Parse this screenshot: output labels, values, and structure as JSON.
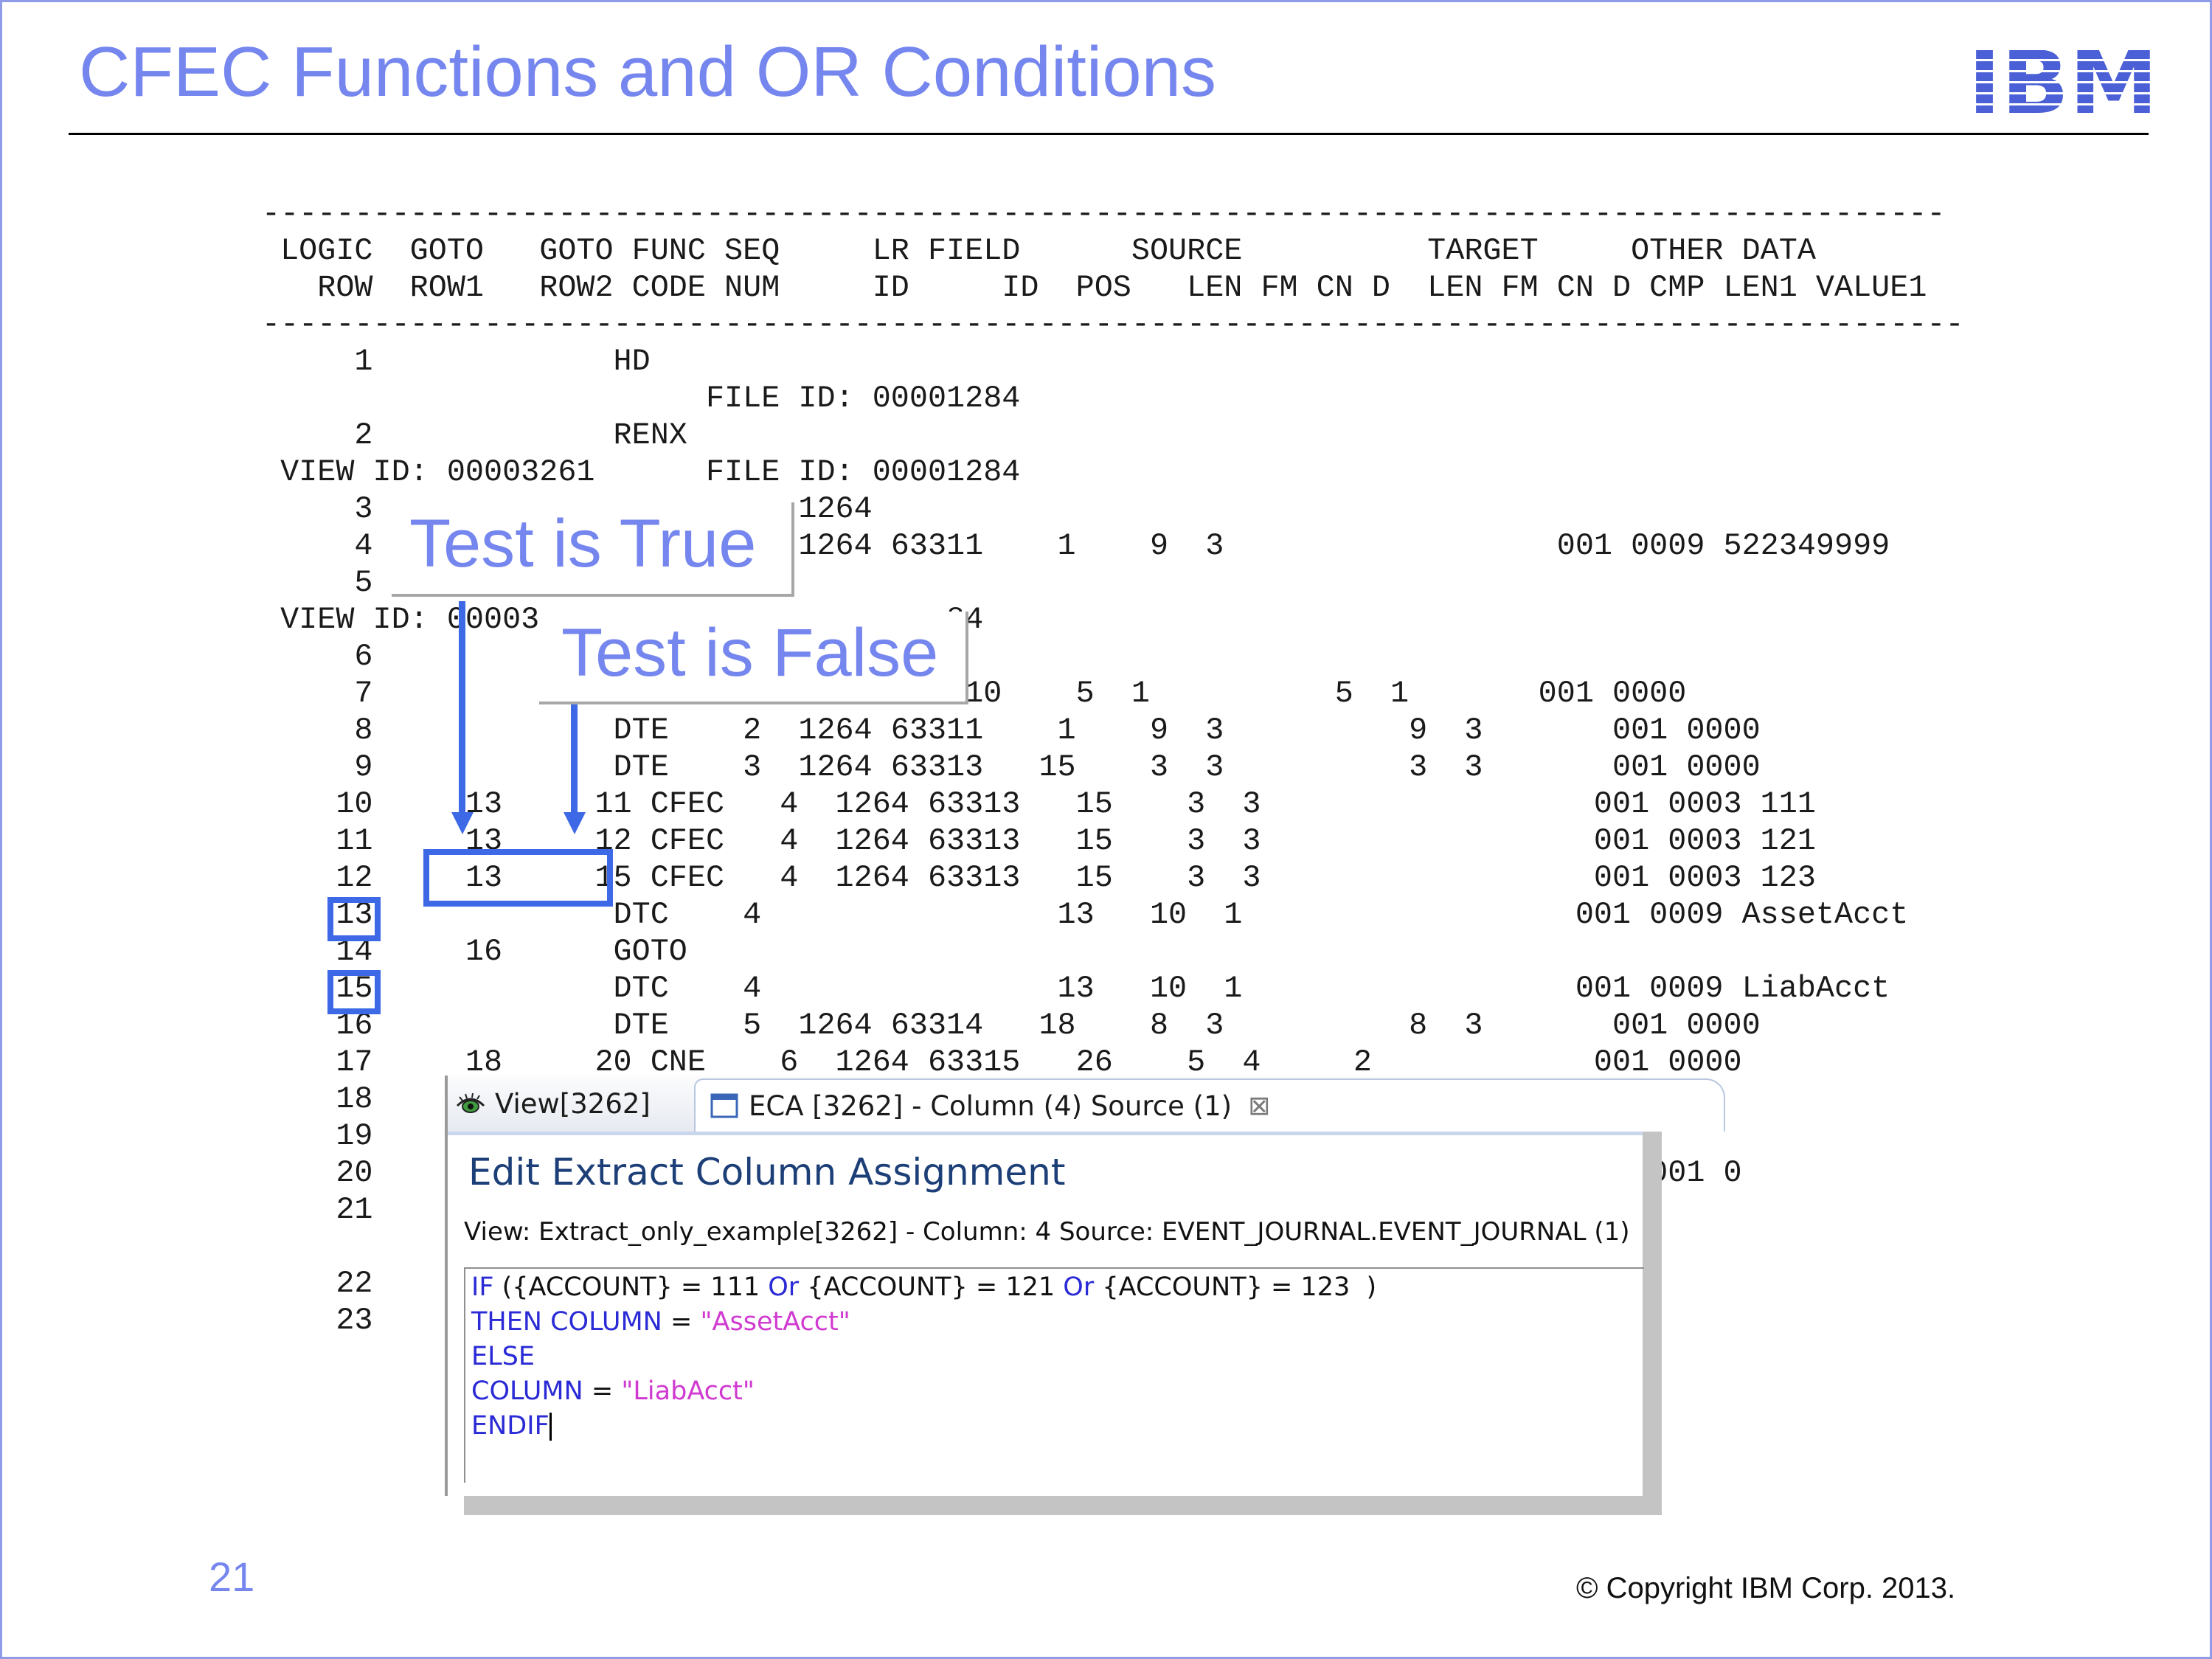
{
  "slide": {
    "title": "CFEC Functions and OR Conditions",
    "logo_text": "IBM",
    "page_number": "21",
    "copyright": "© Copyright IBM Corp. 2013."
  },
  "colors": {
    "title": "#7586ee",
    "arrows_and_boxes": "#3d68e6",
    "logo": "#4b5fd6",
    "code_keyword": "#2a2ad6",
    "code_string": "#d03ad0"
  },
  "listing": {
    "lines": [
      "-------------------------------------------------------------------------------------------",
      " LOGIC  GOTO   GOTO FUNC SEQ     LR FIELD      SOURCE          TARGET     OTHER DATA",
      "   ROW  ROW1   ROW2 CODE NUM     ID     ID  POS   LEN FM CN D  LEN FM CN D CMP LEN1 VALUE1",
      "--------------------------------------------------------------------------------------------",
      "     1             HD",
      "                        FILE ID: 00001284",
      "     2             RENX",
      " VIEW ID: 00003261      FILE ID: 00001284",
      "     3                       1264",
      "     4                       1264 63311    1    9  3                  001 0009 522349999",
      "     5",
      " VIEW ID: 00003                      84",
      "     6",
      "     7                            2   10    5  1          5  1       001 0000",
      "     8             DTE    2  1264 63311    1    9  3          9  3       001 0000",
      "     9             DTE    3  1264 63313   15    3  3          3  3       001 0000",
      "    10     13     11 CFEC   4  1264 63313   15    3  3                  001 0003 111",
      "    11     13     12 CFEC   4  1264 63313   15    3  3                  001 0003 121",
      "    12     13     15 CFEC   4  1264 63313   15    3  3                  001 0003 123",
      "    13             DTC    4                13   10  1                  001 0009 AssetAcct",
      "    14     16      GOTO",
      "    15             DTC    4                13   10  1                  001 0009 LiabAcct",
      "    16             DTE    5  1264 63314   18    8  3          8  3       001 0000",
      "    17     18     20 CNE    6  1264 63315   26    5  4     2            001 0000",
      "    18                                                                    0000",
      "    19",
      "    20                                                                    0001 0",
      "    21",
      "",
      "    22",
      "    23"
    ]
  },
  "callouts": {
    "true_label": "Test is True",
    "false_label": "Test is False"
  },
  "eca_panel": {
    "tabs": {
      "view_tab": "View[3262]",
      "eca_tab": "ECA [3262] - Column (4) Source (1)",
      "close_glyph": "⊠"
    },
    "heading": "Edit Extract Column Assignment",
    "info": "View: Extract_only_example[3262] - Column: 4 Source: EVENT_JOURNAL.EVENT_JOURNAL (1)",
    "code": {
      "if_kw": "IF",
      "cond1": " ({ACCOUNT} = 111 ",
      "or1": "Or",
      "cond2": " {ACCOUNT} = 121 ",
      "or2": "Or",
      "cond3": " {ACCOUNT} = 123  )",
      "then_kw": "THEN COLUMN",
      "eq1": " = ",
      "then_val": "\"AssetAcct\"",
      "else_kw": "ELSE",
      "col_kw": "COLUMN",
      "eq2": " = ",
      "else_val": "\"LiabAcct\"",
      "endif_kw": "ENDIF"
    }
  }
}
